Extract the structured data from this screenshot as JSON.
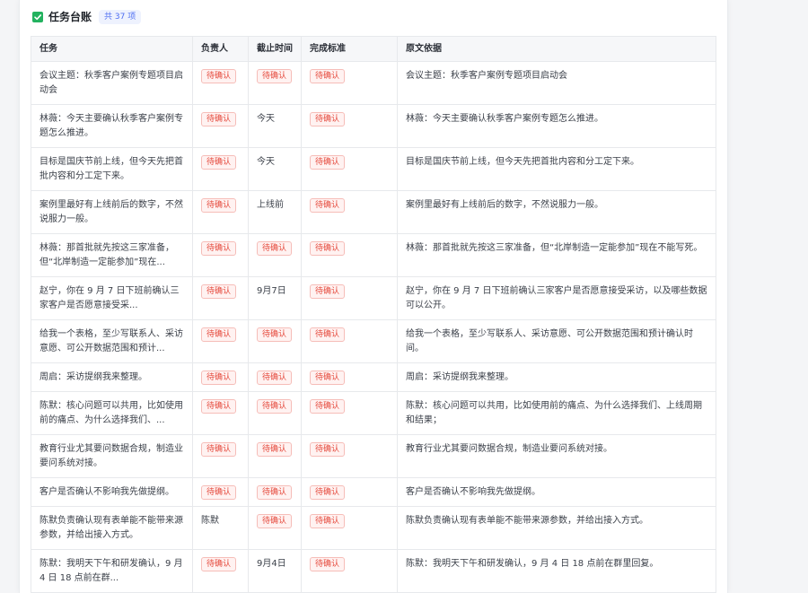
{
  "header": {
    "icon": "checkbox-checked-icon",
    "title": "任务台账",
    "count_badge": "共 37 项"
  },
  "table": {
    "columns": [
      "任务",
      "负责人",
      "截止时间",
      "完成标准",
      "原文依据"
    ],
    "rows": [
      {
        "task": "会议主题：秋季客户案例专题项目启动会",
        "owner": {
          "text": "待确认",
          "badge": true
        },
        "deadline": {
          "text": "待确认",
          "badge": true
        },
        "criteria": {
          "text": "待确认",
          "badge": true
        },
        "source": "会议主题：秋季客户案例专题项目启动会"
      },
      {
        "task": "林薇：今天主要确认秋季客户案例专题怎么推进。",
        "owner": {
          "text": "待确认",
          "badge": true
        },
        "deadline": {
          "text": "今天",
          "badge": false
        },
        "criteria": {
          "text": "待确认",
          "badge": true
        },
        "source": "林薇：今天主要确认秋季客户案例专题怎么推进。"
      },
      {
        "task": "目标是国庆节前上线，但今天先把首批内容和分工定下来。",
        "owner": {
          "text": "待确认",
          "badge": true
        },
        "deadline": {
          "text": "今天",
          "badge": false
        },
        "criteria": {
          "text": "待确认",
          "badge": true
        },
        "source": "目标是国庆节前上线，但今天先把首批内容和分工定下来。"
      },
      {
        "task": "案例里最好有上线前后的数字，不然说服力一般。",
        "owner": {
          "text": "待确认",
          "badge": true
        },
        "deadline": {
          "text": "上线前",
          "badge": false
        },
        "criteria": {
          "text": "待确认",
          "badge": true
        },
        "source": "案例里最好有上线前后的数字，不然说服力一般。"
      },
      {
        "task": "林薇：那首批就先按这三家准备，但“北岸制造一定能参加”现在...",
        "owner": {
          "text": "待确认",
          "badge": true
        },
        "deadline": {
          "text": "待确认",
          "badge": true
        },
        "criteria": {
          "text": "待确认",
          "badge": true
        },
        "source": "林薇：那首批就先按这三家准备，但“北岸制造一定能参加”现在不能写死。"
      },
      {
        "task": "赵宁，你在 9 月 7 日下班前确认三家客户是否愿意接受采...",
        "owner": {
          "text": "待确认",
          "badge": true
        },
        "deadline": {
          "text": "9月7日",
          "badge": false
        },
        "criteria": {
          "text": "待确认",
          "badge": true
        },
        "source": "赵宁，你在 9 月 7 日下班前确认三家客户是否愿意接受采访，以及哪些数据可以公开。"
      },
      {
        "task": "给我一个表格，至少写联系人、采访意愿、可公开数据范围和预计...",
        "owner": {
          "text": "待确认",
          "badge": true
        },
        "deadline": {
          "text": "待确认",
          "badge": true
        },
        "criteria": {
          "text": "待确认",
          "badge": true
        },
        "source": "给我一个表格，至少写联系人、采访意愿、可公开数据范围和预计确认时间。"
      },
      {
        "task": "周启：采访提纲我来整理。",
        "owner": {
          "text": "待确认",
          "badge": true
        },
        "deadline": {
          "text": "待确认",
          "badge": true
        },
        "criteria": {
          "text": "待确认",
          "badge": true
        },
        "source": "周启：采访提纲我来整理。"
      },
      {
        "task": "陈默：核心问题可以共用，比如使用前的痛点、为什么选择我们、...",
        "owner": {
          "text": "待确认",
          "badge": true
        },
        "deadline": {
          "text": "待确认",
          "badge": true
        },
        "criteria": {
          "text": "待确认",
          "badge": true
        },
        "source": "陈默：核心问题可以共用，比如使用前的痛点、为什么选择我们、上线周期和结果；"
      },
      {
        "task": "教育行业尤其要问数据合规，制造业要问系统对接。",
        "owner": {
          "text": "待确认",
          "badge": true
        },
        "deadline": {
          "text": "待确认",
          "badge": true
        },
        "criteria": {
          "text": "待确认",
          "badge": true
        },
        "source": "教育行业尤其要问数据合规，制造业要问系统对接。"
      },
      {
        "task": "客户是否确认不影响我先做提纲。",
        "owner": {
          "text": "待确认",
          "badge": true
        },
        "deadline": {
          "text": "待确认",
          "badge": true
        },
        "criteria": {
          "text": "待确认",
          "badge": true
        },
        "source": "客户是否确认不影响我先做提纲。"
      },
      {
        "task": "陈默负责确认现有表单能不能带来源参数，并给出接入方式。",
        "owner": {
          "text": "陈默",
          "badge": false
        },
        "deadline": {
          "text": "待确认",
          "badge": true
        },
        "criteria": {
          "text": "待确认",
          "badge": true
        },
        "source": "陈默负责确认现有表单能不能带来源参数，并给出接入方式。"
      },
      {
        "task": "陈默：我明天下午和研发确认，9 月 4 日 18 点前在群...",
        "owner": {
          "text": "待确认",
          "badge": true
        },
        "deadline": {
          "text": "9月4日",
          "badge": false
        },
        "criteria": {
          "text": "待确认",
          "badge": true
        },
        "source": "陈默：我明天下午和研发确认，9 月 4 日 18 点前在群里回复。"
      }
    ]
  },
  "colors": {
    "accent_green": "#23b25f",
    "count_badge_bg": "#eef2fe",
    "count_badge_text": "#4e6ef2",
    "pending_badge_bg": "#fff2f1",
    "pending_badge_text": "#e5483b",
    "pending_badge_border": "#f6bdb8"
  }
}
